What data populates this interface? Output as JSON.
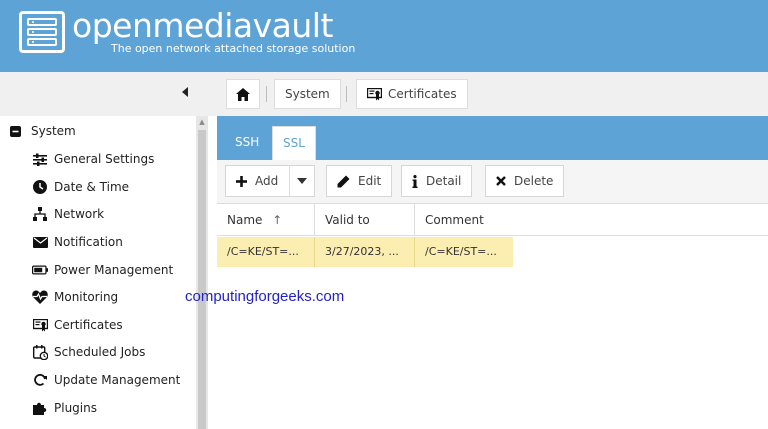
{
  "app": {
    "title": "openmediavault",
    "subtitle": "The open network attached storage solution"
  },
  "breadcrumb": {
    "home_icon": "home-icon",
    "items": [
      {
        "label": "System"
      },
      {
        "label": "Certificates",
        "icon": "certificate-icon"
      }
    ]
  },
  "sidebar": {
    "group": {
      "label": "System",
      "icon": "minus-square-icon"
    },
    "items": [
      {
        "label": "General Settings",
        "icon": "sliders-icon"
      },
      {
        "label": "Date & Time",
        "icon": "clock-icon"
      },
      {
        "label": "Network",
        "icon": "network-icon"
      },
      {
        "label": "Notification",
        "icon": "envelope-icon"
      },
      {
        "label": "Power Management",
        "icon": "battery-icon"
      },
      {
        "label": "Monitoring",
        "icon": "heartbeat-icon"
      },
      {
        "label": "Certificates",
        "icon": "certificate-icon"
      },
      {
        "label": "Scheduled Jobs",
        "icon": "calendar-clock-icon"
      },
      {
        "label": "Update Management",
        "icon": "refresh-icon"
      },
      {
        "label": "Plugins",
        "icon": "puzzle-icon"
      }
    ]
  },
  "tabs": [
    {
      "label": "SSH",
      "active": false
    },
    {
      "label": "SSL",
      "active": true
    }
  ],
  "actions": {
    "add": "Add",
    "edit": "Edit",
    "detail": "Detail",
    "delete": "Delete"
  },
  "table": {
    "columns": [
      "Name",
      "Valid to",
      "Comment"
    ],
    "sort_indicator": "↑",
    "rows": [
      [
        "/C=KE/ST=...",
        "3/27/2023, ...",
        "/C=KE/ST=..."
      ]
    ]
  },
  "watermark": "computingforgeeks.com",
  "colors": {
    "header": "#5ea3d6",
    "selected_row": "#fceeb0",
    "watermark": "#2222cc"
  }
}
